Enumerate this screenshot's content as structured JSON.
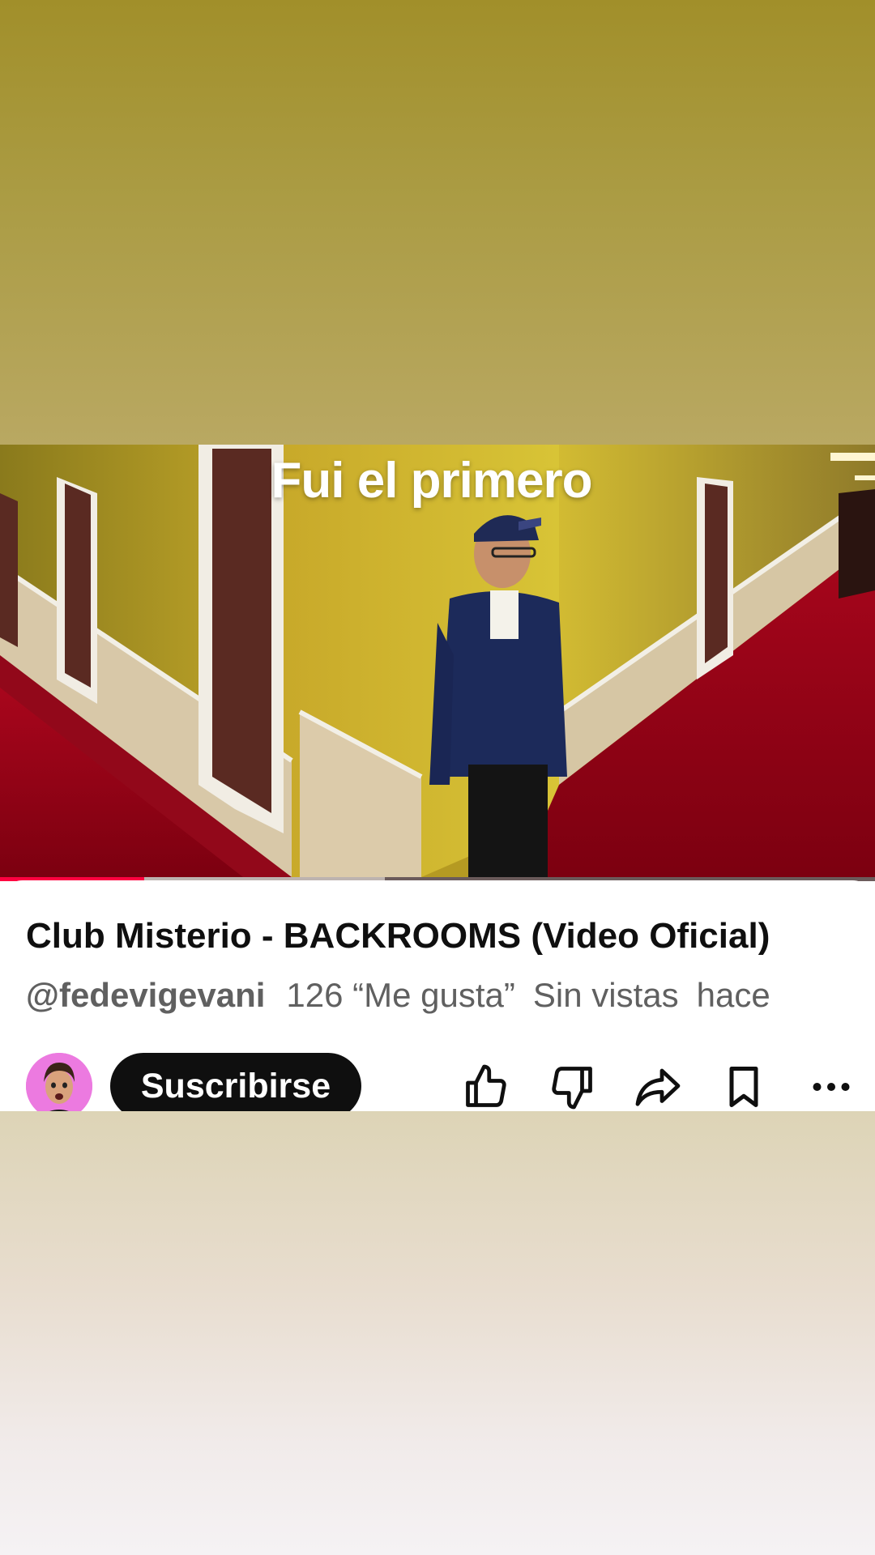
{
  "video": {
    "caption": "Fui el primero",
    "progress_played_fraction": 0.165,
    "progress_buffered_fraction": 0.44
  },
  "info": {
    "title": "Club Misterio - BACKROOMS (Video Oficial)",
    "channel_handle": "@fedevigevani",
    "likes_text": "126 “Me gusta”",
    "views_text": "Sin vistas",
    "time_text": "hace"
  },
  "actions": {
    "subscribe_label": "Suscribirse",
    "icons": [
      "like-icon",
      "dislike-icon",
      "share-icon",
      "save-icon",
      "more-icon"
    ]
  },
  "colors": {
    "progress_accent": "#ff0040",
    "avatar_bg": "#ec7ae0",
    "subscribe_bg": "#0f0f0f"
  }
}
